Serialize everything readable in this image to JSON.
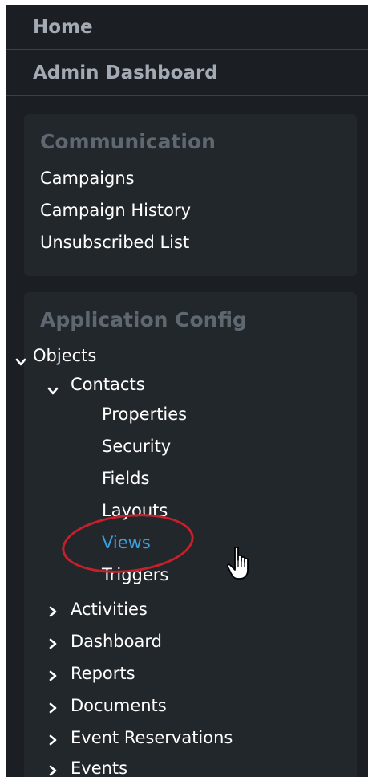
{
  "nav": {
    "home": "Home",
    "admin_dashboard": "Admin Dashboard"
  },
  "communication": {
    "title": "Communication",
    "items": [
      "Campaigns",
      "Campaign History",
      "Unsubscribed List"
    ]
  },
  "app_config": {
    "title": "Application Config",
    "objects": "Objects",
    "contacts": "Contacts",
    "contact_children": [
      "Properties",
      "Security",
      "Fields",
      "Layouts",
      "Views",
      "Triggers"
    ],
    "other_objects": [
      "Activities",
      "Dashboard",
      "Reports",
      "Documents",
      "Event Reservations",
      "Events"
    ],
    "active_item": "Views"
  },
  "colors": {
    "active": "#3aa0e0",
    "highlight": "#c8202a",
    "background": "#1b1f23",
    "panel": "#22272c"
  }
}
